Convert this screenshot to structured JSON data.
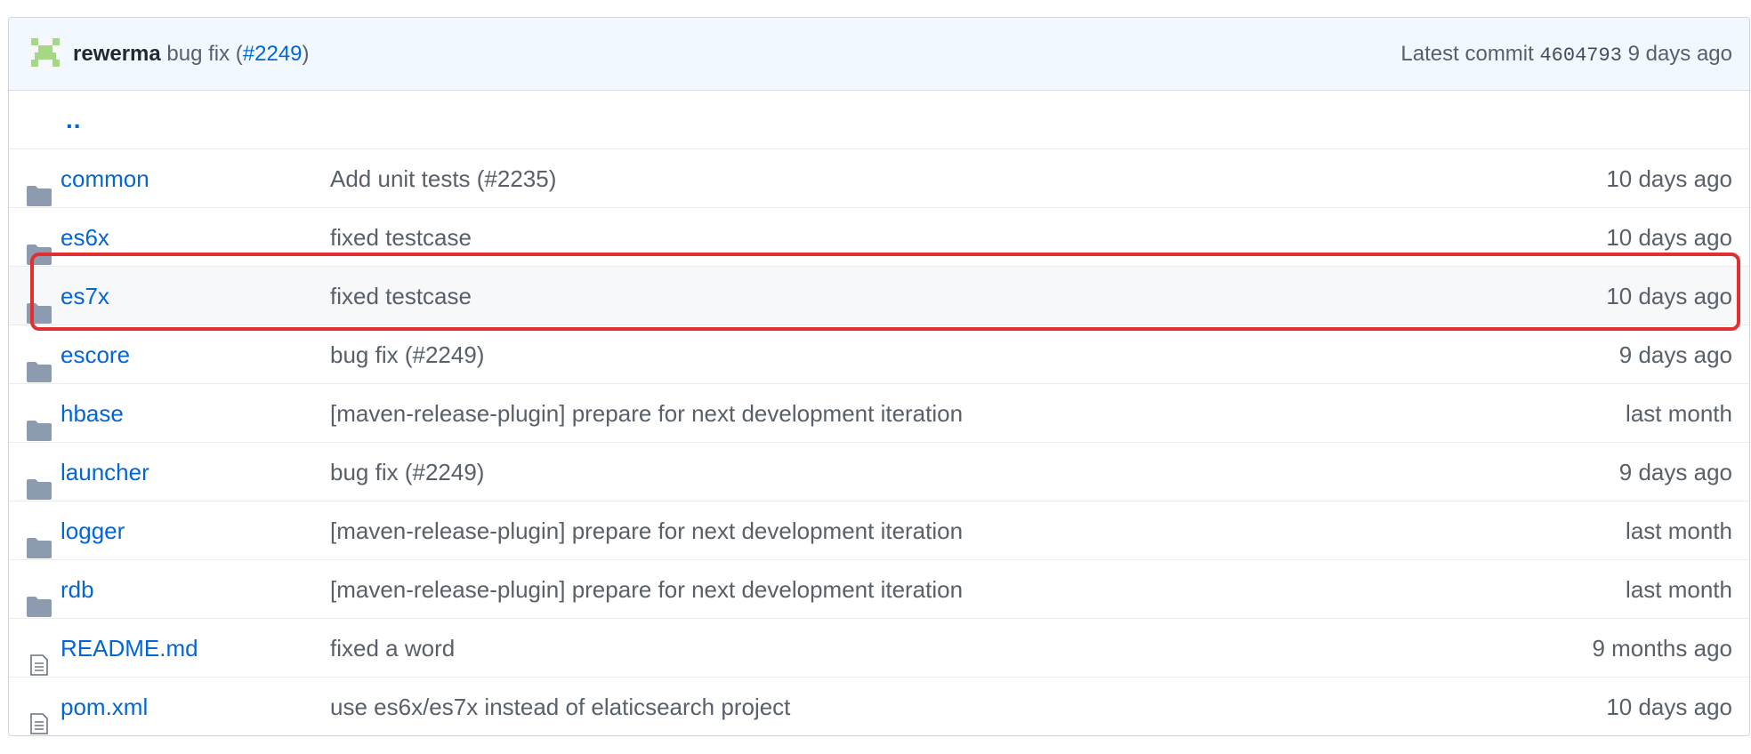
{
  "latest_commit": {
    "author": "rewerma",
    "message_prefix": "bug fix (",
    "message_link": "#2249",
    "message_suffix": ")",
    "latest_label": "Latest commit",
    "sha": "4604793",
    "age": "9 days ago"
  },
  "parent_dir_link": "..",
  "files": [
    {
      "type": "folder",
      "icon": "folder-icon",
      "name": "common",
      "message": "Add unit tests (#2235)",
      "age": "10 days ago"
    },
    {
      "type": "folder",
      "icon": "folder-icon",
      "name": "es6x",
      "message": "fixed testcase",
      "age": "10 days ago"
    },
    {
      "type": "folder",
      "icon": "folder-icon",
      "name": "es7x",
      "message": "fixed testcase",
      "age": "10 days ago"
    },
    {
      "type": "folder",
      "icon": "folder-icon",
      "name": "escore",
      "message": "bug fix (#2249)",
      "age": "9 days ago"
    },
    {
      "type": "folder",
      "icon": "folder-icon",
      "name": "hbase",
      "message": "[maven-release-plugin] prepare for next development iteration",
      "age": "last month"
    },
    {
      "type": "folder",
      "icon": "folder-icon",
      "name": "launcher",
      "message": "bug fix (#2249)",
      "age": "9 days ago"
    },
    {
      "type": "folder",
      "icon": "folder-icon",
      "name": "logger",
      "message": "[maven-release-plugin] prepare for next development iteration",
      "age": "last month"
    },
    {
      "type": "folder",
      "icon": "folder-icon",
      "name": "rdb",
      "message": "[maven-release-plugin] prepare for next development iteration",
      "age": "last month"
    },
    {
      "type": "file",
      "icon": "file-icon",
      "name": "README.md",
      "message": "fixed a word",
      "age": "9 months ago"
    },
    {
      "type": "file",
      "icon": "file-icon",
      "name": "pom.xml",
      "message": "use es6x/es7x instead of elaticsearch project",
      "age": "10 days ago"
    }
  ],
  "highlighted_row": "es7x",
  "colors": {
    "link": "#0366d6",
    "header_bg": "#f1f8ff",
    "annotation": "#e03030",
    "folder_icon": "#79b8ff"
  }
}
